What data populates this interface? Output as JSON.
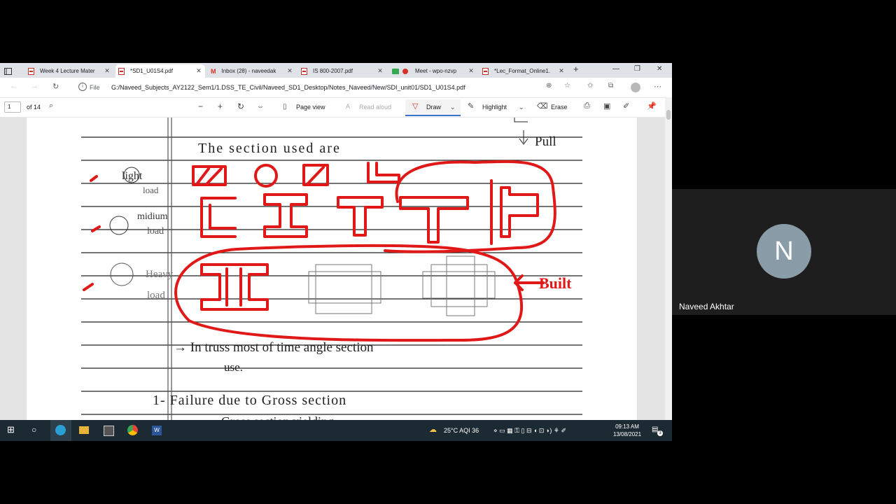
{
  "browser": {
    "tabs": [
      {
        "label": "Week 4 Lecture Mater",
        "active": false
      },
      {
        "label": "*SD1_U01S4.pdf",
        "active": true
      },
      {
        "label": "Inbox (28) - naveedak",
        "active": false
      },
      {
        "label": "IS 800-2007.pdf",
        "active": false
      },
      {
        "label": "Meet - wpo-nzvp",
        "active": false
      },
      {
        "label": "*Lec_Format_Online1.",
        "active": false
      }
    ],
    "address": {
      "scheme_label": "File",
      "url": "G:/Naveed_Subjects_AY2122_Sem1/1.DSS_TE_Civil/Naveed_SD1_Desktop/Notes_Naveed/New/SDI_unit01/SD1_U01S4.pdf"
    }
  },
  "pdf_toolbar": {
    "page_current": "1",
    "page_total": "of 14",
    "page_view": "Page view",
    "read_aloud": "Read aloud",
    "draw": "Draw",
    "highlight": "Highlight",
    "erase": "Erase"
  },
  "notes": {
    "pull": "Pull",
    "title": "The section used are",
    "row1": "(1) light load",
    "row1_a": "light",
    "row1_b": "load",
    "row2_a": "midium",
    "row2_b": "load",
    "row3_a": "Heavy",
    "row3_b": "load",
    "built": "Built",
    "truss_line1": "→ In truss most of time angle section",
    "truss_line2": "use.",
    "failure": "1- Failure due to Gross section",
    "gross": "Gross section yielding"
  },
  "taskbar": {
    "weather": "25°C",
    "aqi": "AQI 36",
    "time": "09:13 AM",
    "date": "13/08/2021",
    "notifications": "3"
  },
  "meeting": {
    "participant_initial": "N",
    "participant_name": "Naveed Akhtar"
  }
}
